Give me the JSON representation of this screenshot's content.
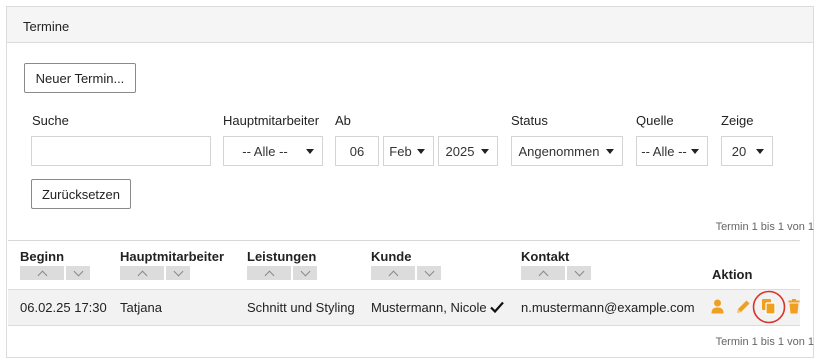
{
  "panel": {
    "title": "Termine"
  },
  "toolbar": {
    "new_label": "Neuer Termin...",
    "reset_label": "Zurücksetzen"
  },
  "filters": {
    "search": {
      "label": "Suche",
      "value": ""
    },
    "employee": {
      "label": "Hauptmitarbeiter",
      "value": "-- Alle --"
    },
    "from": {
      "label": "Ab",
      "day": "06",
      "month": "Feb",
      "year": "2025"
    },
    "status": {
      "label": "Status",
      "value": "Angenommen"
    },
    "source": {
      "label": "Quelle",
      "value": "-- Alle --"
    },
    "show": {
      "label": "Zeige",
      "value": "20"
    }
  },
  "result_count_top": "Termin 1 bis 1 von 1",
  "result_count_bottom": "Termin 1 bis 1 von 1",
  "table": {
    "columns": [
      "Beginn",
      "Hauptmitarbeiter",
      "Leistungen",
      "Kunde",
      "Kontakt",
      "Aktion"
    ],
    "rows": [
      {
        "begin": "06.02.25 17:30",
        "employee": "Tatjana",
        "service": "Schnitt und Styling",
        "customer": "Mustermann, Nicole",
        "contact": "n.mustermann@example.com"
      }
    ]
  },
  "colors": {
    "action_orange": "#f0a020",
    "highlight_ring": "#d9342b"
  },
  "icons": [
    "person-icon",
    "pencil-icon",
    "copy-icon",
    "trash-icon",
    "checkmark-icon"
  ]
}
